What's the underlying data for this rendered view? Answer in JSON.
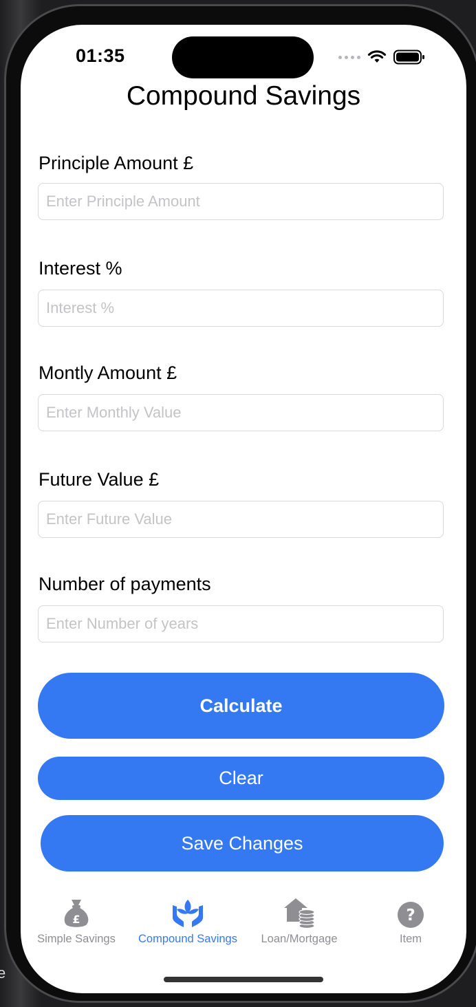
{
  "status": {
    "time": "01:35"
  },
  "screen_title": "Compound Savings",
  "fields": [
    {
      "label": "Principle Amount £",
      "placeholder": "Enter Principle Amount",
      "value": ""
    },
    {
      "label": "Interest %",
      "placeholder": "Interest %",
      "value": ""
    },
    {
      "label": "Montly Amount £",
      "placeholder": "Enter Monthly Value",
      "value": ""
    },
    {
      "label": "Future Value £",
      "placeholder": "Enter Future Value",
      "value": ""
    },
    {
      "label": "Number of payments",
      "placeholder": "Enter Number of years",
      "value": ""
    }
  ],
  "buttons": {
    "calculate": "Calculate",
    "clear": "Clear",
    "save": "Save Changes"
  },
  "tabs": [
    {
      "label": "Simple Savings",
      "icon": "money-bag-pound-icon",
      "active": false
    },
    {
      "label": "Compound Savings",
      "icon": "hands-plant-icon",
      "active": true
    },
    {
      "label": "Loan/Mortgage",
      "icon": "house-coins-icon",
      "active": false
    },
    {
      "label": "Item",
      "icon": "question-circle-icon",
      "active": false
    }
  ],
  "colors": {
    "accent": "#3579f2",
    "inactive_tab": "#8e8e93",
    "placeholder": "#c4c4c7"
  },
  "edge_text": "e"
}
